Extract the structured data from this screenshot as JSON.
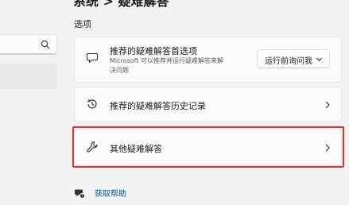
{
  "header": {
    "title": "系统 > 疑难解答"
  },
  "section": {
    "label": "选项"
  },
  "cards": [
    {
      "title": "推荐的疑难解答首选项",
      "description": "Microsoft 可以推荐并运行疑难解答来解决问题",
      "dropdown_value": "运行前询问我",
      "icon": "chat-bubble-icon"
    },
    {
      "title": "推荐的疑难解答历史记录",
      "icon": "history-icon"
    },
    {
      "title": "其他疑难解答",
      "icon": "wrench-icon"
    }
  ],
  "help": {
    "label": "获取帮助",
    "icon": "help-icon"
  },
  "colors": {
    "accent_link": "#0058a3",
    "highlight": "#e03131"
  }
}
